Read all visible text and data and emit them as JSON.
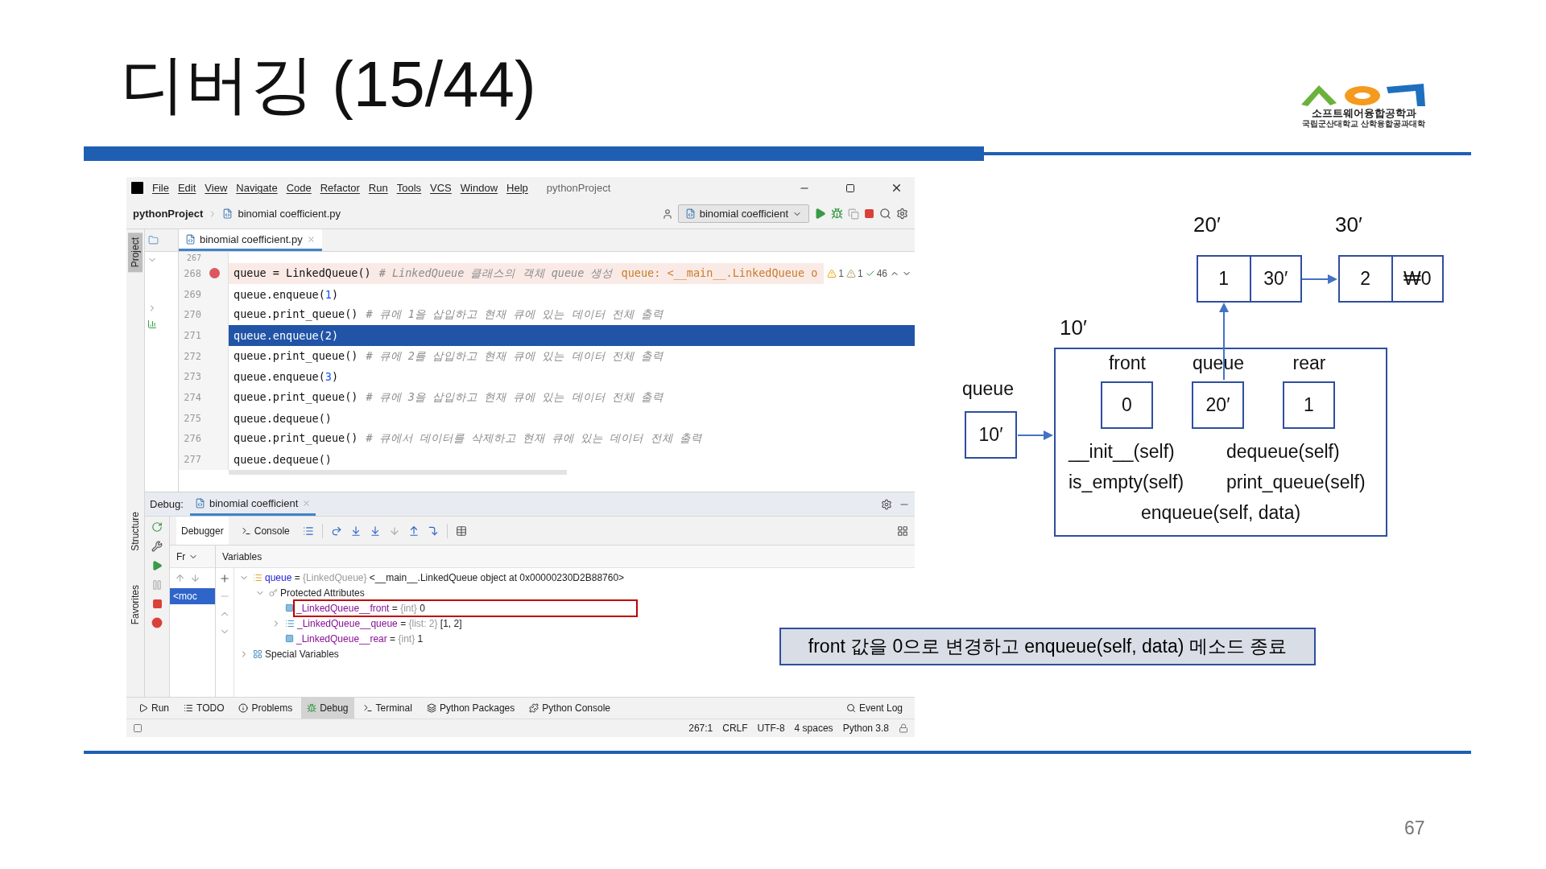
{
  "slide": {
    "title": "디버깅 (15/44)",
    "page_number": "67",
    "logo": {
      "line_1": "소프트웨어융합공학과",
      "line_2": "국립군산대학교 산학융합공과대학"
    }
  },
  "ide": {
    "menu": [
      "File",
      "Edit",
      "View",
      "Navigate",
      "Code",
      "Refactor",
      "Run",
      "Tools",
      "VCS",
      "Window",
      "Help"
    ],
    "window_title": "pythonProject",
    "breadcrumb": [
      "pythonProject",
      "binomial coefficient.py"
    ],
    "run_config": "binomial coefficient",
    "stripe_tabs": [
      {
        "label": "Project",
        "selected": true
      },
      {
        "label": "Structure",
        "selected": false
      },
      {
        "label": "Favorites",
        "selected": false
      }
    ],
    "editor_tab": {
      "label": "binomial coefficient.py",
      "selected": true
    },
    "inspections": [
      {
        "kind": "error",
        "count": "1"
      },
      {
        "kind": "warning",
        "count": "1"
      },
      {
        "kind": "ok",
        "count": "46"
      }
    ],
    "code_lines": [
      {
        "number": "267",
        "breakpoint": false,
        "current": false
      },
      {
        "number": "268",
        "breakpoint": true,
        "current": false,
        "tokens": [
          {
            "kind": "code",
            "text": "queue = LinkedQueue()"
          },
          {
            "kind": "comment",
            "text": "# LinkedQueue 클래스의 객체 queue 생성"
          },
          {
            "kind": "inline",
            "text": "queue: <__main__.LinkedQueue o"
          }
        ]
      },
      {
        "number": "269",
        "breakpoint": false,
        "current": false,
        "tokens": [
          {
            "kind": "code",
            "text": "queue.enqueue("
          },
          {
            "kind": "number",
            "text": "1"
          },
          {
            "kind": "code",
            "text": ")"
          }
        ]
      },
      {
        "number": "270",
        "breakpoint": false,
        "current": false,
        "tokens": [
          {
            "kind": "code",
            "text": "queue.print_queue()"
          },
          {
            "kind": "comment",
            "text": "# 큐에 1을 삽입하고 현재 큐에 있는 데이터 전체 출력"
          }
        ]
      },
      {
        "number": "271",
        "breakpoint": false,
        "current": true,
        "tokens": [
          {
            "kind": "code",
            "text": "queue.enqueue("
          },
          {
            "kind": "number",
            "text": "2"
          },
          {
            "kind": "code",
            "text": ")"
          }
        ]
      },
      {
        "number": "272",
        "breakpoint": false,
        "current": false,
        "tokens": [
          {
            "kind": "code",
            "text": "queue.print_queue()"
          },
          {
            "kind": "comment",
            "text": "# 큐에 2를 삽입하고 현재 큐에 있는 데이터 전체 출력"
          }
        ]
      },
      {
        "number": "273",
        "breakpoint": false,
        "current": false,
        "tokens": [
          {
            "kind": "code",
            "text": "queue.enqueue("
          },
          {
            "kind": "number",
            "text": "3"
          },
          {
            "kind": "code",
            "text": ")"
          }
        ]
      },
      {
        "number": "274",
        "breakpoint": false,
        "current": false,
        "tokens": [
          {
            "kind": "code",
            "text": "queue.print_queue()"
          },
          {
            "kind": "comment",
            "text": "# 큐에 3을 삽입하고 현재 큐에 있는 데이터 전체 출력"
          }
        ]
      },
      {
        "number": "275",
        "breakpoint": false,
        "current": false,
        "tokens": [
          {
            "kind": "code",
            "text": "queue.dequeue()"
          }
        ]
      },
      {
        "number": "276",
        "breakpoint": false,
        "current": false,
        "tokens": [
          {
            "kind": "code",
            "text": "queue.print_queue()"
          },
          {
            "kind": "comment",
            "text": "# 큐에서 데이터를 삭제하고 현재 큐에 있는 데이터 전체 출력"
          }
        ]
      },
      {
        "number": "277",
        "breakpoint": false,
        "current": false,
        "tokens": [
          {
            "kind": "code",
            "text": "queue.dequeue()"
          }
        ]
      }
    ],
    "debug": {
      "label": "Debug:",
      "session": "binomial coefficient",
      "tabs": [
        {
          "label": "Debugger",
          "selected": true
        },
        {
          "label": "Console",
          "selected": false
        }
      ],
      "frames_header": "Fr",
      "frame": "<moc",
      "variables_header": "Variables",
      "variables": [
        {
          "kind": "object",
          "name": "queue",
          "sign": "=",
          "type": "{LinkedQueue}",
          "value": "<__main__.LinkedQueue object at 0x00000230D2B88760>",
          "expanded": true,
          "boxed": false,
          "children": [
            {
              "kind": "group",
              "name": "Protected Attributes",
              "expanded": true,
              "boxed": false,
              "children": [
                {
                  "kind": "int",
                  "name": "_LinkedQueue__front",
                  "sign": "=",
                  "type": "{int}",
                  "value": "0",
                  "boxed": true
                },
                {
                  "kind": "list",
                  "name": "_LinkedQueue__queue",
                  "sign": "=",
                  "type": "{list: 2}",
                  "value": "[1, 2]",
                  "expanded": false,
                  "boxed": false
                },
                {
                  "kind": "int",
                  "name": "_LinkedQueue__rear",
                  "sign": "=",
                  "type": "{int}",
                  "value": "1",
                  "boxed": false
                }
              ]
            }
          ]
        },
        {
          "kind": "special",
          "name": "Special Variables",
          "expanded": false,
          "boxed": false
        }
      ]
    },
    "tool_windows": [
      {
        "kind": "run",
        "label": "Run",
        "selected": false
      },
      {
        "kind": "todo",
        "label": "TODO",
        "selected": false
      },
      {
        "kind": "problems",
        "label": "Problems",
        "selected": false
      },
      {
        "kind": "debug",
        "label": "Debug",
        "selected": true
      },
      {
        "kind": "terminal",
        "label": "Terminal",
        "selected": false
      },
      {
        "kind": "packages",
        "label": "Python Packages",
        "selected": false
      },
      {
        "kind": "console",
        "label": "Python Console",
        "selected": false
      }
    ],
    "event_log": "Event Log",
    "status": [
      "267:1",
      "CRLF",
      "UTF-8",
      "4 spaces",
      "Python 3.8"
    ]
  },
  "diagram": {
    "variable": {
      "label": "queue",
      "value": "10′"
    },
    "object": {
      "address": "10′",
      "fields": [
        {
          "label": "front",
          "value": "0"
        },
        {
          "label": "queue",
          "value": "20′"
        },
        {
          "label": "rear",
          "value": "1"
        }
      ],
      "methods": [
        "__init__(self)",
        "dequeue(self)",
        "is_empty(self)",
        "print_queue(self)",
        "enqueue(self, data)"
      ]
    },
    "nodes": [
      {
        "address": "20′",
        "data": "1",
        "link": "30′"
      },
      {
        "address": "30′",
        "data": "2",
        "link": "₩0"
      }
    ]
  },
  "callout": "front 값을 0으로 변경하고 enqueue(self, data) 메소드 종료"
}
